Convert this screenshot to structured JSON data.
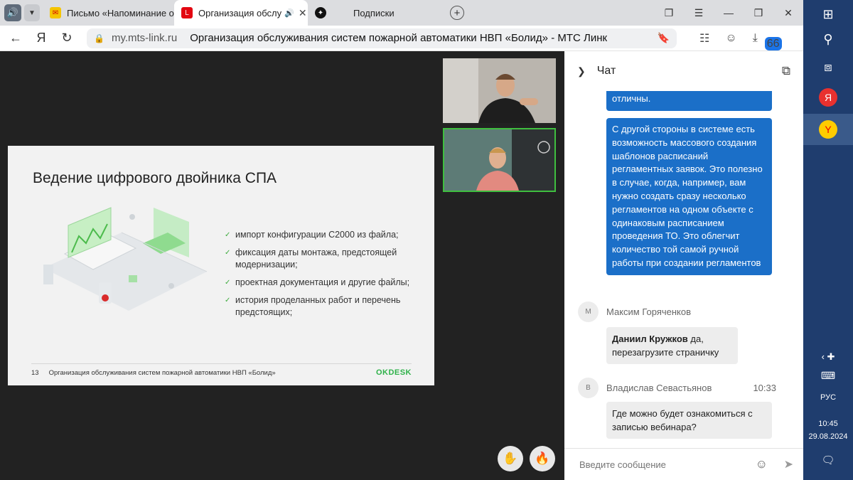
{
  "browser": {
    "tabs": [
      {
        "label": "Письмо «Напоминание о"
      },
      {
        "label": "Организация обслу"
      },
      {
        "label": "Подписки"
      }
    ],
    "url_host": "my.mts-link.ru",
    "page_title": "Организация обслуживания систем пожарной автоматики НВП «Болид» - МТС Линк",
    "downloads_badge": "66"
  },
  "slide": {
    "title": "Ведение цифрового двойника СПА",
    "bullets": [
      "импорт конфигурации С2000 из файла;",
      "фиксация даты монтажа, предстоящей модернизации;",
      "проектная документация и другие файлы;",
      "история проделанных работ и перечень предстоящих;"
    ],
    "page_number": "13",
    "footer": "Организация обслуживания систем пожарной автоматики НВП «Болид»",
    "logo": "OKDESK"
  },
  "chat": {
    "title": "Чат",
    "msg_partial": "отличны.",
    "msg_long": "С другой стороны в системе есть возможность массового создания шаблонов расписаний регламентных заявок. Это полезно в случае, когда, например, вам нужно создать сразу несколько регламентов на одном объекте с одинаковым расписанием проведения ТО. Это облегчит количество той самой ручной работы при создании регламентов",
    "m1": {
      "avatar": "М",
      "author": "Максим Горяченков",
      "mention": "Даниил Кружков",
      "text": " да, перезагрузите страничку"
    },
    "m2": {
      "avatar": "В",
      "author": "Владислав Севастьянов",
      "time": "10:33",
      "text": "Где можно будет ознакомиться с записью вебинара?"
    },
    "input_placeholder": "Введите сообщение"
  },
  "taskbar": {
    "lang": "РУС",
    "time": "10:45",
    "date": "29.08.2024"
  }
}
